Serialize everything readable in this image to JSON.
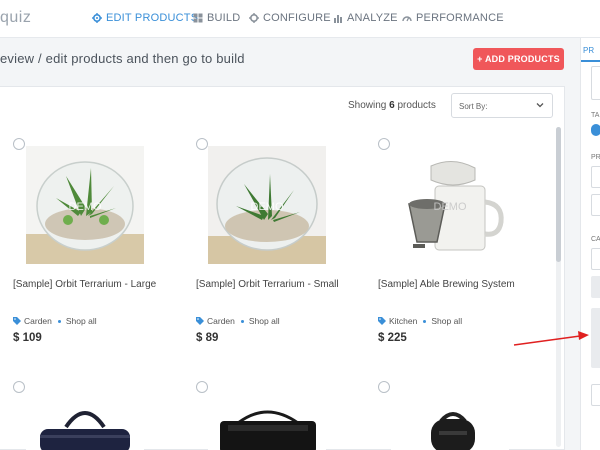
{
  "brand": "quiz",
  "nav": {
    "items": [
      {
        "label": "EDIT PRODUCTS",
        "icon": "gear-icon",
        "active": true
      },
      {
        "label": "BUILD",
        "icon": "grid-icon",
        "active": false
      },
      {
        "label": "CONFIGURE",
        "icon": "cog-icon",
        "active": false
      },
      {
        "label": "ANALYZE",
        "icon": "bar-chart-icon",
        "active": false
      },
      {
        "label": "PERFORMANCE",
        "icon": "gauge-icon",
        "active": false
      }
    ]
  },
  "page": {
    "title": "eview / edit products and then go to build",
    "add_button": "+ ADD PRODUCTS"
  },
  "toolbar": {
    "showing_prefix": "Showing",
    "showing_count": "6",
    "showing_suffix": "products",
    "sort_label": "Sort By:"
  },
  "products": [
    {
      "name": "[Sample] Orbit Terrarium - Large",
      "category": "Carden",
      "shop_all": "Shop all",
      "price": "$ 109"
    },
    {
      "name": "[Sample] Orbit Terrarium - Small",
      "category": "Carden",
      "shop_all": "Shop all",
      "price": "$ 89"
    },
    {
      "name": "[Sample] Able Brewing System",
      "category": "Kitchen",
      "shop_all": "Shop all",
      "price": "$ 225"
    }
  ],
  "watermark": "DEMO",
  "sidebar": {
    "tab": "PR",
    "labels": [
      "TA",
      "PR",
      "CA"
    ]
  },
  "colors": {
    "accent": "#3a8fd8",
    "add_button": "#f0575a",
    "arrow": "#e02020"
  }
}
